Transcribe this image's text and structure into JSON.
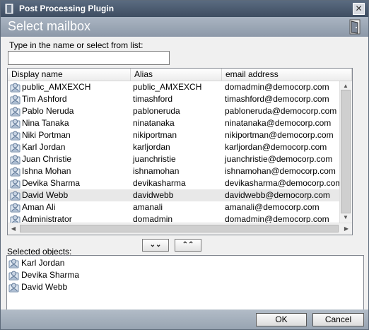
{
  "window": {
    "title": "Post Processing Plugin",
    "close_glyph": "✕"
  },
  "header": {
    "title": "Select mailbox",
    "icon": "door-icon"
  },
  "search": {
    "prompt": "Type in the name or select from list:",
    "value": "",
    "placeholder": ""
  },
  "table": {
    "columns": [
      "Display name",
      "Alias",
      "email address"
    ],
    "rows": [
      {
        "name": "public_AMXEXCH",
        "alias": "public_AMXEXCH",
        "email": "domadmin@democorp.com",
        "selected": false
      },
      {
        "name": "Tim Ashford",
        "alias": "timashford",
        "email": "timashford@democorp.com",
        "selected": false
      },
      {
        "name": "Pablo Neruda",
        "alias": "pabloneruda",
        "email": "pabloneruda@democorp.com",
        "selected": false
      },
      {
        "name": "Nina Tanaka",
        "alias": "ninatanaka",
        "email": "ninatanaka@democorp.com",
        "selected": false
      },
      {
        "name": "Niki Portman",
        "alias": "nikiportman",
        "email": "nikiportman@democorp.com",
        "selected": false
      },
      {
        "name": "Karl Jordan",
        "alias": "karljordan",
        "email": "karljordan@democorp.com",
        "selected": false
      },
      {
        "name": "Juan Christie",
        "alias": "juanchristie",
        "email": "juanchristie@democorp.com",
        "selected": false
      },
      {
        "name": "Ishna Mohan",
        "alias": "ishnamohan",
        "email": "ishnamohan@democorp.com",
        "selected": false
      },
      {
        "name": "Devika Sharma",
        "alias": "devikasharma",
        "email": "devikasharma@democorp.com",
        "selected": false
      },
      {
        "name": "David Webb",
        "alias": "davidwebb",
        "email": "davidwebb@democorp.com",
        "selected": true
      },
      {
        "name": "Aman Ali",
        "alias": "amanali",
        "email": "amanali@democorp.com",
        "selected": false
      },
      {
        "name": "Administrator",
        "alias": "domadmin",
        "email": "domadmin@democorp.com",
        "selected": false
      }
    ]
  },
  "move": {
    "down_glyph": "⌄⌄",
    "up_glyph": "⌃⌃"
  },
  "selected": {
    "label": "Selected objects:",
    "items": [
      "Karl Jordan",
      "Devika Sharma",
      "David Webb"
    ]
  },
  "buttons": {
    "ok": "OK",
    "cancel": "Cancel"
  }
}
